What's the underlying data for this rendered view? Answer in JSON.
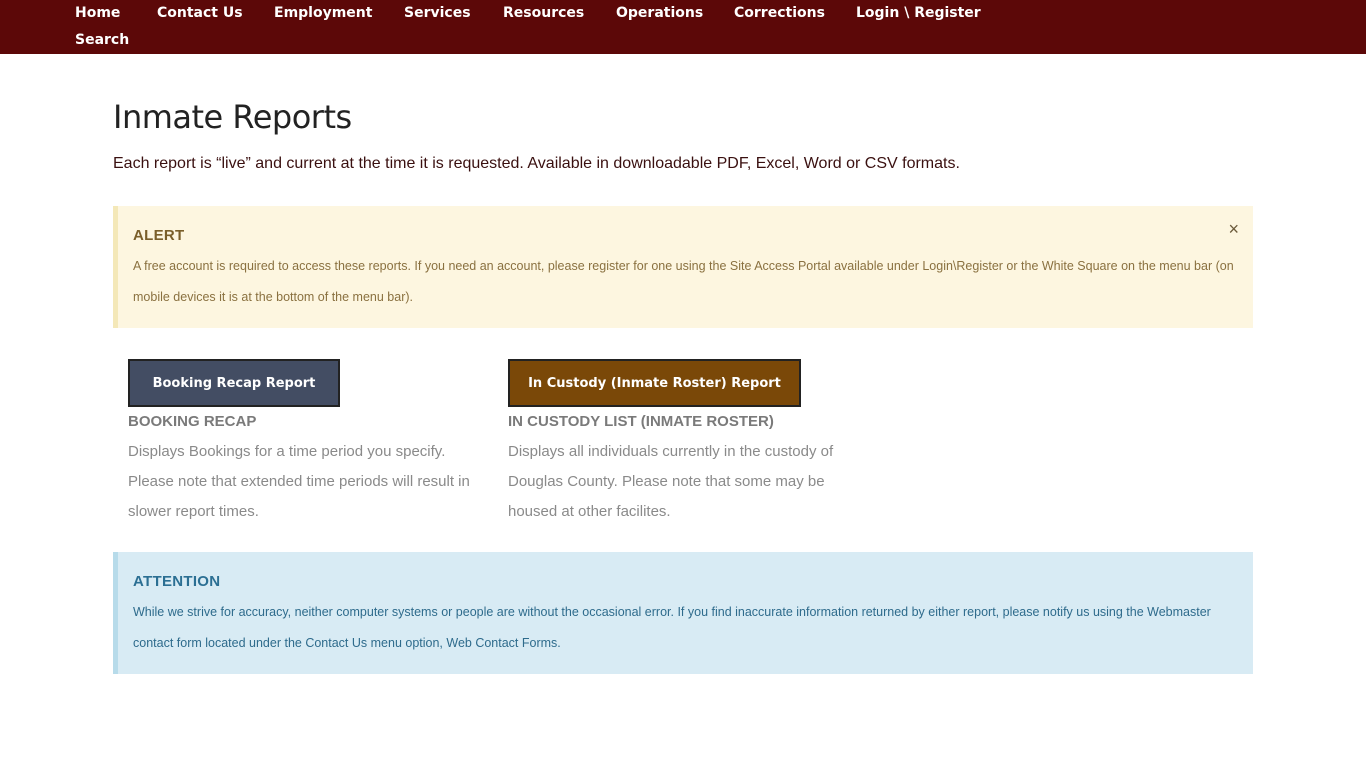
{
  "nav": {
    "items": [
      {
        "label": "Home"
      },
      {
        "label": "Contact Us"
      },
      {
        "label": "Employment"
      },
      {
        "label": "Services"
      },
      {
        "label": "Resources"
      },
      {
        "label": "Operations"
      },
      {
        "label": "Corrections"
      },
      {
        "label": "Login \\ Register"
      },
      {
        "label": "Search"
      }
    ]
  },
  "page": {
    "title": "Inmate Reports",
    "intro": "Each report is “live” and current at the time it is requested. Available in downloadable PDF, Excel, Word or CSV formats."
  },
  "alert": {
    "title": "ALERT",
    "text": "A free account is required to access these reports. If you need an account, please register for one using the Site Access Portal available under Login\\Register or the White Square on the menu bar (on mobile devices it is at the bottom of the menu bar).",
    "close": "×"
  },
  "reports": [
    {
      "button_label": "Booking Recap Report",
      "title": "BOOKING RECAP",
      "description": "Displays Bookings for a time period you specify. Please note that extended time periods will result in slower report times."
    },
    {
      "button_label": "In Custody (Inmate Roster) Report",
      "title": "IN CUSTODY LIST (INMATE ROSTER)",
      "description": "Displays all individuals currently in the custody of Douglas County. Please note that some may be housed at other facilites."
    }
  ],
  "attention": {
    "title": "ATTENTION",
    "text": "While we strive for accuracy, neither computer systems or people are without the occasional error. If you find inaccurate information returned by either report, please notify us using the Webmaster contact form located under the Contact Us menu option, Web Contact Forms."
  },
  "colors": {
    "nav_bg": "#5c0808",
    "alert_bg": "#fdf6e0",
    "attention_bg": "#d8ebf4",
    "booking_button": "#434d63",
    "custody_button": "#7a4808"
  }
}
